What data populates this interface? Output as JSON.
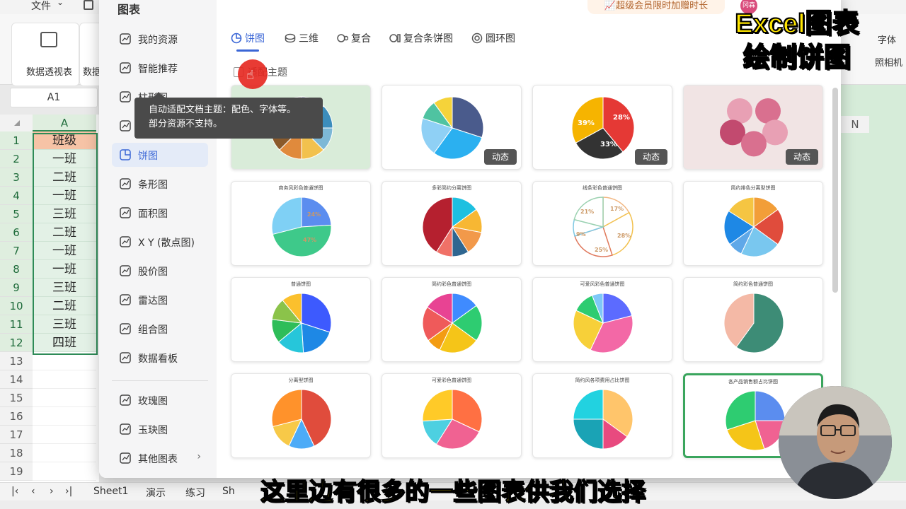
{
  "app": {
    "file_menu": "文件"
  },
  "ribbon": {
    "tools": [
      "数据透视表",
      "数据"
    ]
  },
  "namebox": "A1",
  "sheet": {
    "column": "A",
    "rows": [
      {
        "n": "1",
        "v": "班级"
      },
      {
        "n": "2",
        "v": "一班"
      },
      {
        "n": "3",
        "v": "二班"
      },
      {
        "n": "4",
        "v": "一班"
      },
      {
        "n": "5",
        "v": "三班"
      },
      {
        "n": "6",
        "v": "二班"
      },
      {
        "n": "7",
        "v": "一班"
      },
      {
        "n": "8",
        "v": "一班"
      },
      {
        "n": "9",
        "v": "三班"
      },
      {
        "n": "10",
        "v": "二班"
      },
      {
        "n": "11",
        "v": "三班"
      },
      {
        "n": "12",
        "v": "四班"
      },
      {
        "n": "13",
        "v": ""
      },
      {
        "n": "14",
        "v": ""
      },
      {
        "n": "15",
        "v": ""
      },
      {
        "n": "16",
        "v": ""
      },
      {
        "n": "17",
        "v": ""
      },
      {
        "n": "18",
        "v": ""
      },
      {
        "n": "19",
        "v": ""
      }
    ],
    "right_col": "N",
    "tabs": [
      "Sheet1",
      "演示",
      "练习",
      "Sh"
    ]
  },
  "dialog": {
    "title": "图表",
    "sidebar": [
      {
        "label": "我的资源",
        "icon": "user-icon"
      },
      {
        "label": "智能推荐",
        "icon": "smart-icon"
      },
      {
        "label": "柱形图",
        "icon": "bar-chart-icon"
      },
      {
        "label": "折线图",
        "icon": "line-chart-icon"
      },
      {
        "label": "饼图",
        "icon": "pie-chart-icon"
      },
      {
        "label": "条形图",
        "icon": "hbar-chart-icon"
      },
      {
        "label": "面积图",
        "icon": "area-chart-icon"
      },
      {
        "label": "X Y (散点图)",
        "icon": "scatter-icon"
      },
      {
        "label": "股价图",
        "icon": "stock-icon"
      },
      {
        "label": "雷达图",
        "icon": "radar-icon"
      },
      {
        "label": "组合图",
        "icon": "combo-icon"
      },
      {
        "label": "数据看板",
        "icon": "dashboard-icon"
      },
      {
        "label": "玫瑰图",
        "icon": "rose-icon"
      },
      {
        "label": "玉玦图",
        "icon": "jade-icon"
      },
      {
        "label": "其他图表",
        "icon": "more-icon"
      }
    ],
    "tabs": [
      "饼图",
      "三维",
      "复合",
      "复合条饼图",
      "圆环图"
    ],
    "theme_checkbox": "适配主题",
    "tooltip": [
      "自动适配文档主题：配色、字体等。",
      "部分资源不支持。"
    ],
    "dynamic_badge": "动态",
    "cards": [
      {
        "title": ""
      },
      {
        "title": ""
      },
      {
        "title": ""
      },
      {
        "title": ""
      },
      {
        "title": "商务风彩色普通饼图"
      },
      {
        "title": "多彩简约分离饼图"
      },
      {
        "title": "线条彩色普通饼图"
      },
      {
        "title": "简约排色分离型饼图"
      },
      {
        "title": "普通饼图"
      },
      {
        "title": "简约彩色普通饼图"
      },
      {
        "title": "可爱风彩色普通饼图"
      },
      {
        "title": "简约彩色普通饼图"
      },
      {
        "title": "分离型饼图"
      },
      {
        "title": "可爱彩色普通饼图"
      },
      {
        "title": "简约风各项费用占比饼图"
      },
      {
        "title": "各产品销售额占比饼图"
      }
    ],
    "pie3_labels": [
      "39%",
      "28%",
      "33%"
    ],
    "card5_labels": [
      "24%",
      "47%"
    ],
    "card7_labels": [
      "21%",
      "17%",
      "28%",
      "25%",
      "9%"
    ]
  },
  "promo": "超级会员限时加赠时长",
  "user_badge": "冈森",
  "right_labels": [
    "字体",
    "照相机"
  ],
  "overlay_title": [
    "Excel图表",
    "绘制饼图"
  ],
  "subtitle": "这里边有很多的一些图表供我们选择",
  "colors": {
    "accent": "#3a66d6",
    "selection_green": "#2e8b57",
    "caption_yellow": "#ffe600",
    "promo_text": "#b0622a"
  }
}
